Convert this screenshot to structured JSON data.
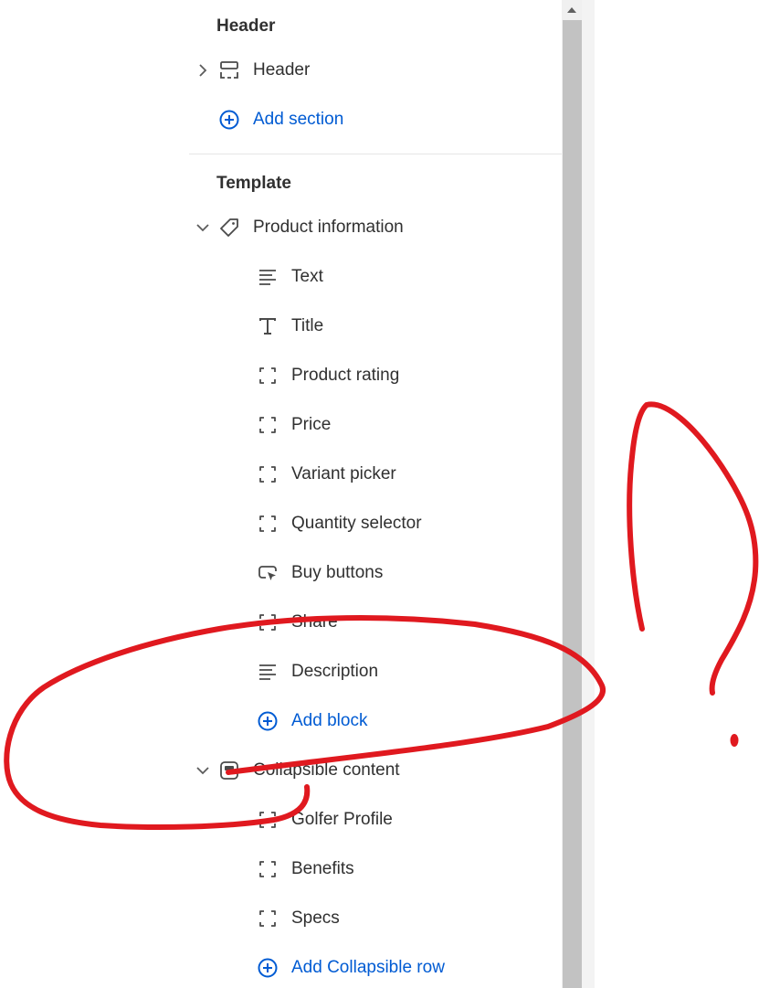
{
  "header_group": {
    "title": "Header",
    "section_label": "Header",
    "add_label": "Add section"
  },
  "template_group": {
    "title": "Template",
    "product_section": "Product information",
    "blocks": [
      "Text",
      "Title",
      "Product rating",
      "Price",
      "Variant picker",
      "Quantity selector",
      "Buy buttons",
      "Share",
      "Description"
    ],
    "add_block_label": "Add block",
    "collapsible_section": "Collapsible content",
    "collapsible_rows": [
      "Golfer Profile",
      "Benefits",
      "Specs"
    ],
    "add_row_label": "Add Collapsible row"
  },
  "colors": {
    "accent": "#005bd3",
    "annotation": "#e0191f"
  }
}
